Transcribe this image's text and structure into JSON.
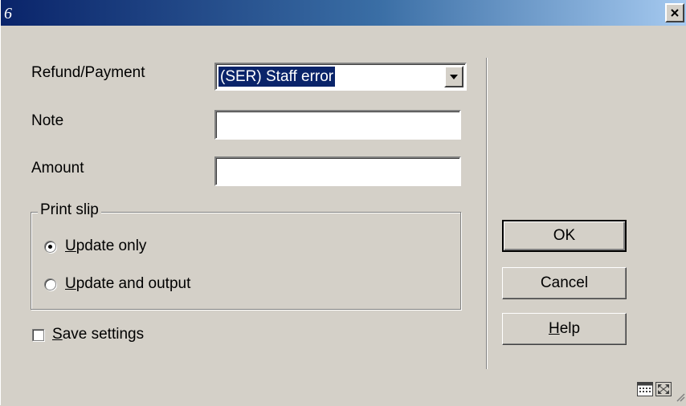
{
  "window": {
    "title": "",
    "close_label": "×"
  },
  "form": {
    "refund_label": "Refund/Payment",
    "refund_value": "(SER) Staff error",
    "note_label": "Note",
    "note_value": "",
    "amount_label": "Amount",
    "amount_value": ""
  },
  "print_slip": {
    "legend": "Print slip",
    "options": [
      {
        "accel": "U",
        "rest": "pdate only",
        "checked": true
      },
      {
        "accel": "U",
        "rest": "pdate and output",
        "checked": false
      }
    ]
  },
  "save_settings": {
    "accel": "S",
    "rest": "ave settings",
    "checked": false
  },
  "buttons": {
    "ok": "OK",
    "cancel": "Cancel",
    "help_accel": "H",
    "help_rest": "elp"
  },
  "icons": {
    "app": "reload-icon",
    "status_left": "calendar-icon",
    "status_right": "maximize-icon",
    "grip": "resize-grip-icon"
  },
  "colors": {
    "titlebar_start": "#0a246a",
    "titlebar_end": "#a6caf0",
    "dialog_bg": "#d4d0c8",
    "selection": "#0a246a"
  }
}
